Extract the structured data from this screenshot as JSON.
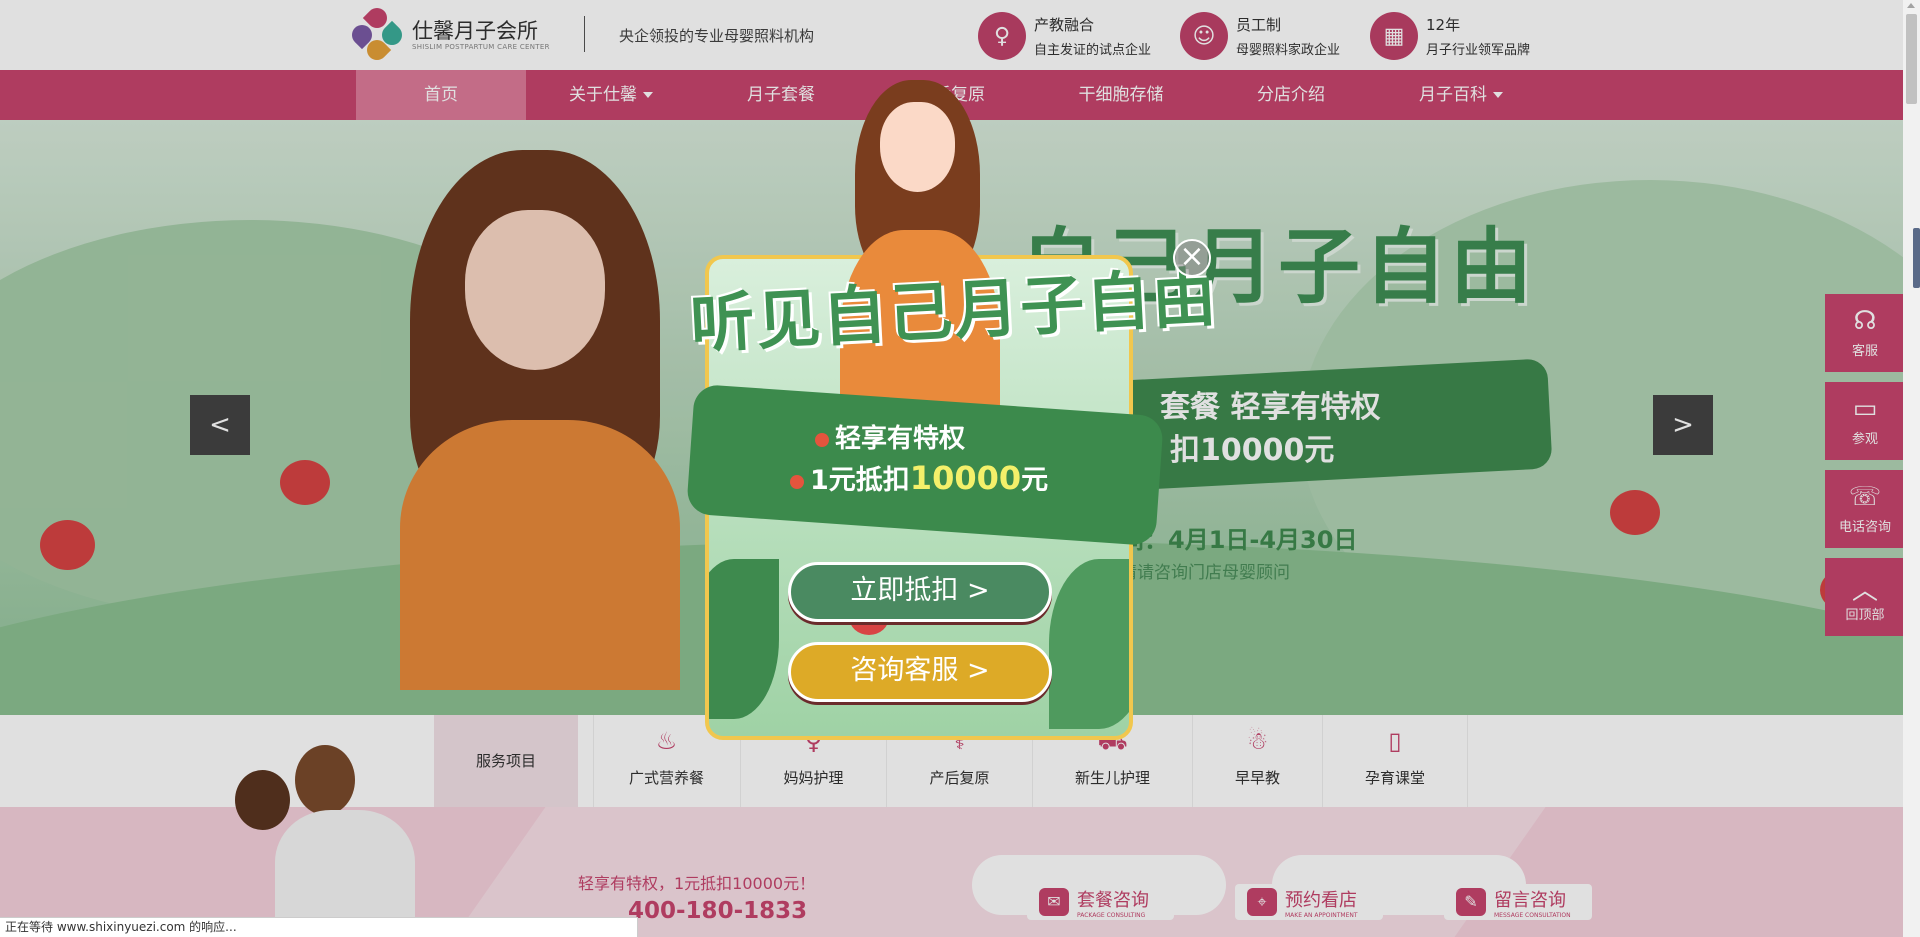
{
  "header": {
    "logo_cn": "仕馨月子会所",
    "logo_en": "SHISLIM POSTPARTUM CARE CENTER",
    "slogan": "央企领投的专业母婴照料机构",
    "info": [
      {
        "icon": "pregnant-icon",
        "title": "产教融合",
        "subtitle": "自主发证的试点企业"
      },
      {
        "icon": "staff-icon",
        "title": "员工制",
        "subtitle": "母婴照料家政企业"
      },
      {
        "icon": "building-icon",
        "title": "12年",
        "subtitle": "月子行业领军品牌"
      }
    ]
  },
  "nav": {
    "items": [
      "首页",
      "关于仕馨",
      "月子套餐",
      "产后复原",
      "干细胞存储",
      "分店介绍",
      "月子百科"
    ],
    "active_index": 0
  },
  "banner": {
    "title": "自己月子自由",
    "ribbon_line1": "套餐 轻享有特权",
    "ribbon_line2": "扣10000元",
    "date": "间：4月1日-4月30日",
    "note": "情请咨询门店母婴顾问",
    "prev": "<",
    "next": ">"
  },
  "services": {
    "heading": "服务项目",
    "items": [
      {
        "icon": "bowl-icon",
        "label": "广式营养餐"
      },
      {
        "icon": "mother-icon",
        "label": "妈妈护理"
      },
      {
        "icon": "recovery-icon",
        "label": "产后复原"
      },
      {
        "icon": "stroller-icon",
        "label": "新生儿护理"
      },
      {
        "icon": "duck-icon",
        "label": "早早教"
      },
      {
        "icon": "book-icon",
        "label": "孕育课堂"
      }
    ]
  },
  "promo": {
    "line1": "轻享有特权，1元抵扣10000元！",
    "phone": "400-180-1833"
  },
  "sidebar": [
    {
      "icon": "headset-icon",
      "label": "客服"
    },
    {
      "icon": "bed-icon",
      "label": "参观"
    },
    {
      "icon": "phone-icon",
      "label": "电话咨询"
    },
    {
      "icon": "up-arrow-icon",
      "label": "回顶部"
    }
  ],
  "bottombar": [
    {
      "icon": "chat-icon",
      "label": "套餐咨询",
      "sub": "PACKAGE CONSULTING"
    },
    {
      "icon": "location-icon",
      "label": "预约看店",
      "sub": "MAKE AN APPOINTMENT"
    },
    {
      "icon": "clipboard-icon",
      "label": "留言咨询",
      "sub": "MESSAGE CONSULTATION"
    }
  ],
  "popup": {
    "title": "听见自己月子自由",
    "line1": "轻享有特权",
    "line2_pre": "1元抵扣",
    "line2_hi": "10000",
    "line2_post": "元",
    "btn_primary": "立即抵扣 >",
    "btn_secondary": "咨询客服 >",
    "close": "×"
  },
  "status_text": "正在等待 www.shixinyuezi.com 的响应...",
  "colors": {
    "brand_pink": "#c8456e",
    "popup_green": "#3c8a4c",
    "popup_gold": "#ddaa27"
  }
}
